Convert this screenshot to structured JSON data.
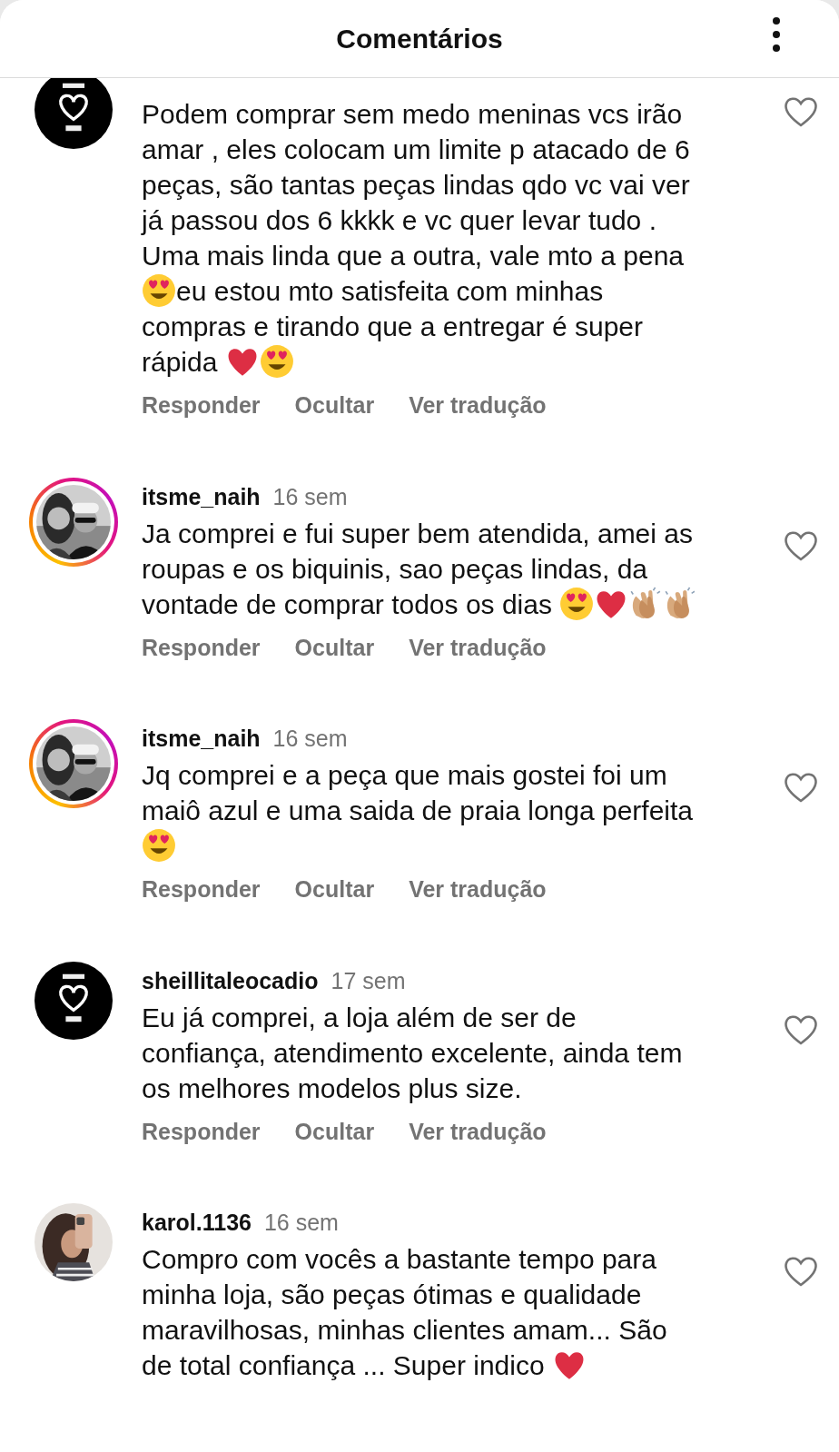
{
  "header": {
    "title": "Comentários"
  },
  "comments": [
    {
      "avatar": {
        "kind": "picture",
        "story_ring": false
      },
      "liked": false,
      "parts": [
        {
          "kind": "text",
          "text": "Podem comprar sem medo meninas vcs irão amar , eles colocam um limite p atacado de 6 peças, são tantas peças lindas qdo vc vai ver já passou dos 6 kkkk e vc quer levar tudo . Uma mais linda que a outra, vale mto a pena"
        },
        {
          "kind": "heart-eyes"
        },
        {
          "kind": "text",
          "text": "eu estou mto satisfeita com minhas compras e tirando que a entregar é super rápida "
        },
        {
          "kind": "red-heart"
        },
        {
          "kind": "heart-eyes"
        }
      ],
      "actions": [
        "Responder",
        "Ocultar",
        "Ver tradução"
      ]
    },
    {
      "username": "itsme_naih",
      "time": "16 sem",
      "avatar": {
        "kind": "picture",
        "story_ring": true
      },
      "liked": false,
      "parts": [
        {
          "kind": "text",
          "text": "Ja comprei e fui super bem atendida, amei as roupas e os biquinis, sao peças lindas, da vontade de comprar todos os dias "
        },
        {
          "kind": "heart-eyes"
        },
        {
          "kind": "red-heart"
        },
        {
          "kind": "clap"
        },
        {
          "kind": "clap"
        }
      ],
      "actions": [
        "Responder",
        "Ocultar",
        "Ver tradução"
      ]
    },
    {
      "username": "itsme_naih",
      "time": "16 sem",
      "avatar": {
        "kind": "picture",
        "story_ring": true
      },
      "liked": false,
      "parts": [
        {
          "kind": "text",
          "text": "Jq comprei e a peça que mais gostei foi um maiô azul e uma saida de praia longa perfeita "
        },
        {
          "kind": "heart-eyes"
        }
      ],
      "actions": [
        "Responder",
        "Ocultar",
        "Ver tradução"
      ]
    },
    {
      "username": "sheillitaleocadio",
      "time": "17 sem",
      "avatar": {
        "kind": "picture",
        "story_ring": false
      },
      "liked": false,
      "parts": [
        {
          "kind": "text",
          "text": "Eu já comprei, a loja além de ser de confiança, atendimento excelente, ainda tem os melhores modelos plus size."
        }
      ],
      "actions": [
        "Responder",
        "Ocultar",
        "Ver tradução"
      ]
    },
    {
      "username": "karol.1136",
      "time": "16 sem",
      "avatar": {
        "kind": "picture",
        "story_ring": false
      },
      "liked": false,
      "parts": [
        {
          "kind": "text",
          "text": "Compro com vocês a bastante tempo para minha loja, são peças ótimas e qualidade maravilhosas, minhas clientes amam... São de total confiança ... Super indico "
        },
        {
          "kind": "red-heart"
        }
      ]
    }
  ]
}
